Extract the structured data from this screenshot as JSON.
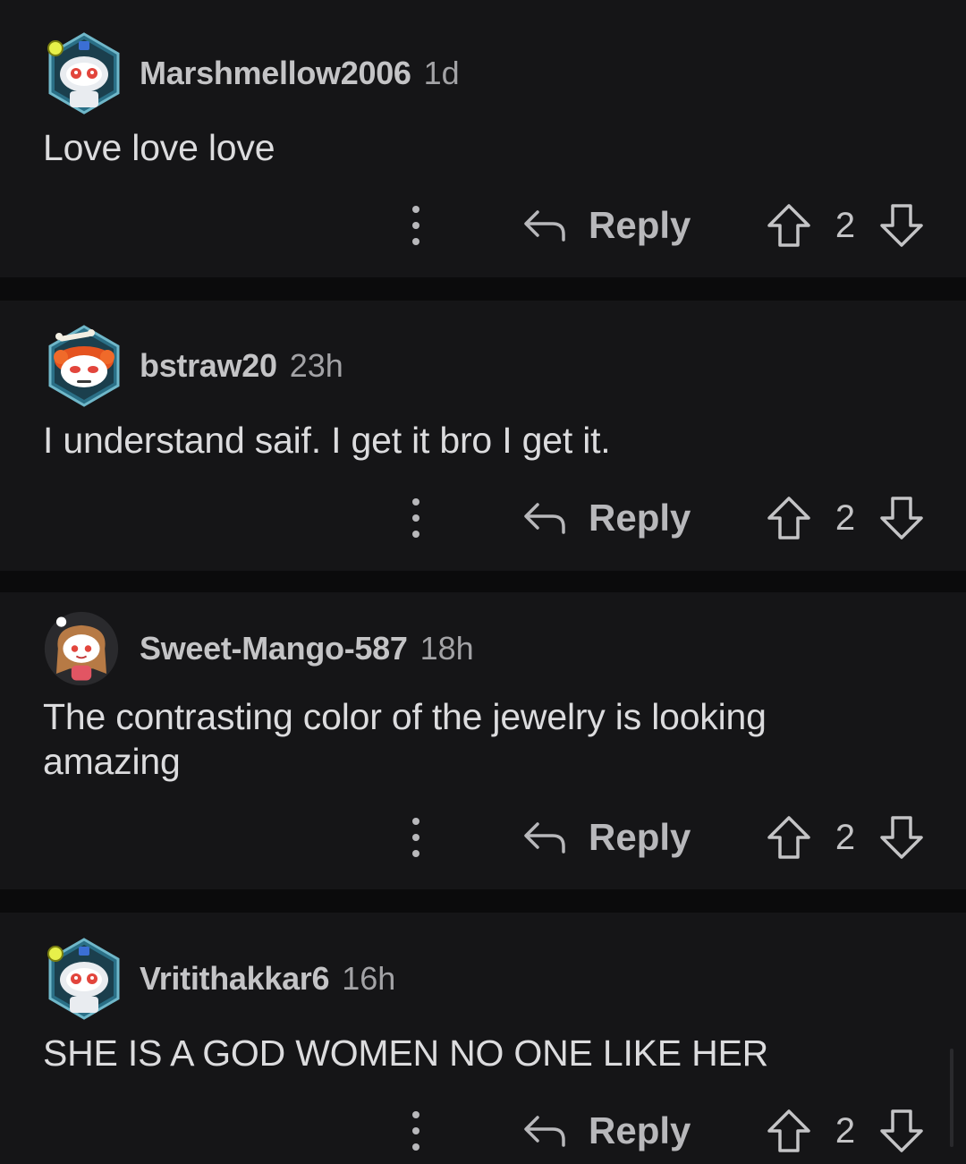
{
  "comments": [
    {
      "author": "Marshmellow2006",
      "time": "1d",
      "text": "Love love love",
      "reply_label": "Reply",
      "score": "2",
      "avatar": "snoo-robot-avatar"
    },
    {
      "author": "bstraw20",
      "time": "23h",
      "text": "I understand saif. I get it bro I get it.",
      "reply_label": "Reply",
      "score": "2",
      "avatar": "snoo-redhair-avatar"
    },
    {
      "author": "Sweet-Mango-587",
      "time": "18h",
      "text": "The contrasting color of the jewelry is looking amazing",
      "reply_label": "Reply",
      "score": "2",
      "avatar": "snoo-girl-avatar"
    },
    {
      "author": "Vritithakkar6",
      "time": "16h",
      "text": "SHE IS A GOD WOMEN NO ONE LIKE HER",
      "reply_label": "Reply",
      "score": "2",
      "avatar": "snoo-robot-avatar"
    }
  ],
  "icons": {
    "more": "more-vertical-icon",
    "reply": "reply-arrow-icon",
    "upvote": "upvote-arrow-icon",
    "downvote": "downvote-arrow-icon"
  },
  "colors": {
    "background": "#0b0b0c",
    "card": "#151517",
    "author": "#c4c4c6",
    "body": "#dcdcde",
    "icon": "#b8b8bb",
    "hex_border": "#6fb7c9"
  }
}
